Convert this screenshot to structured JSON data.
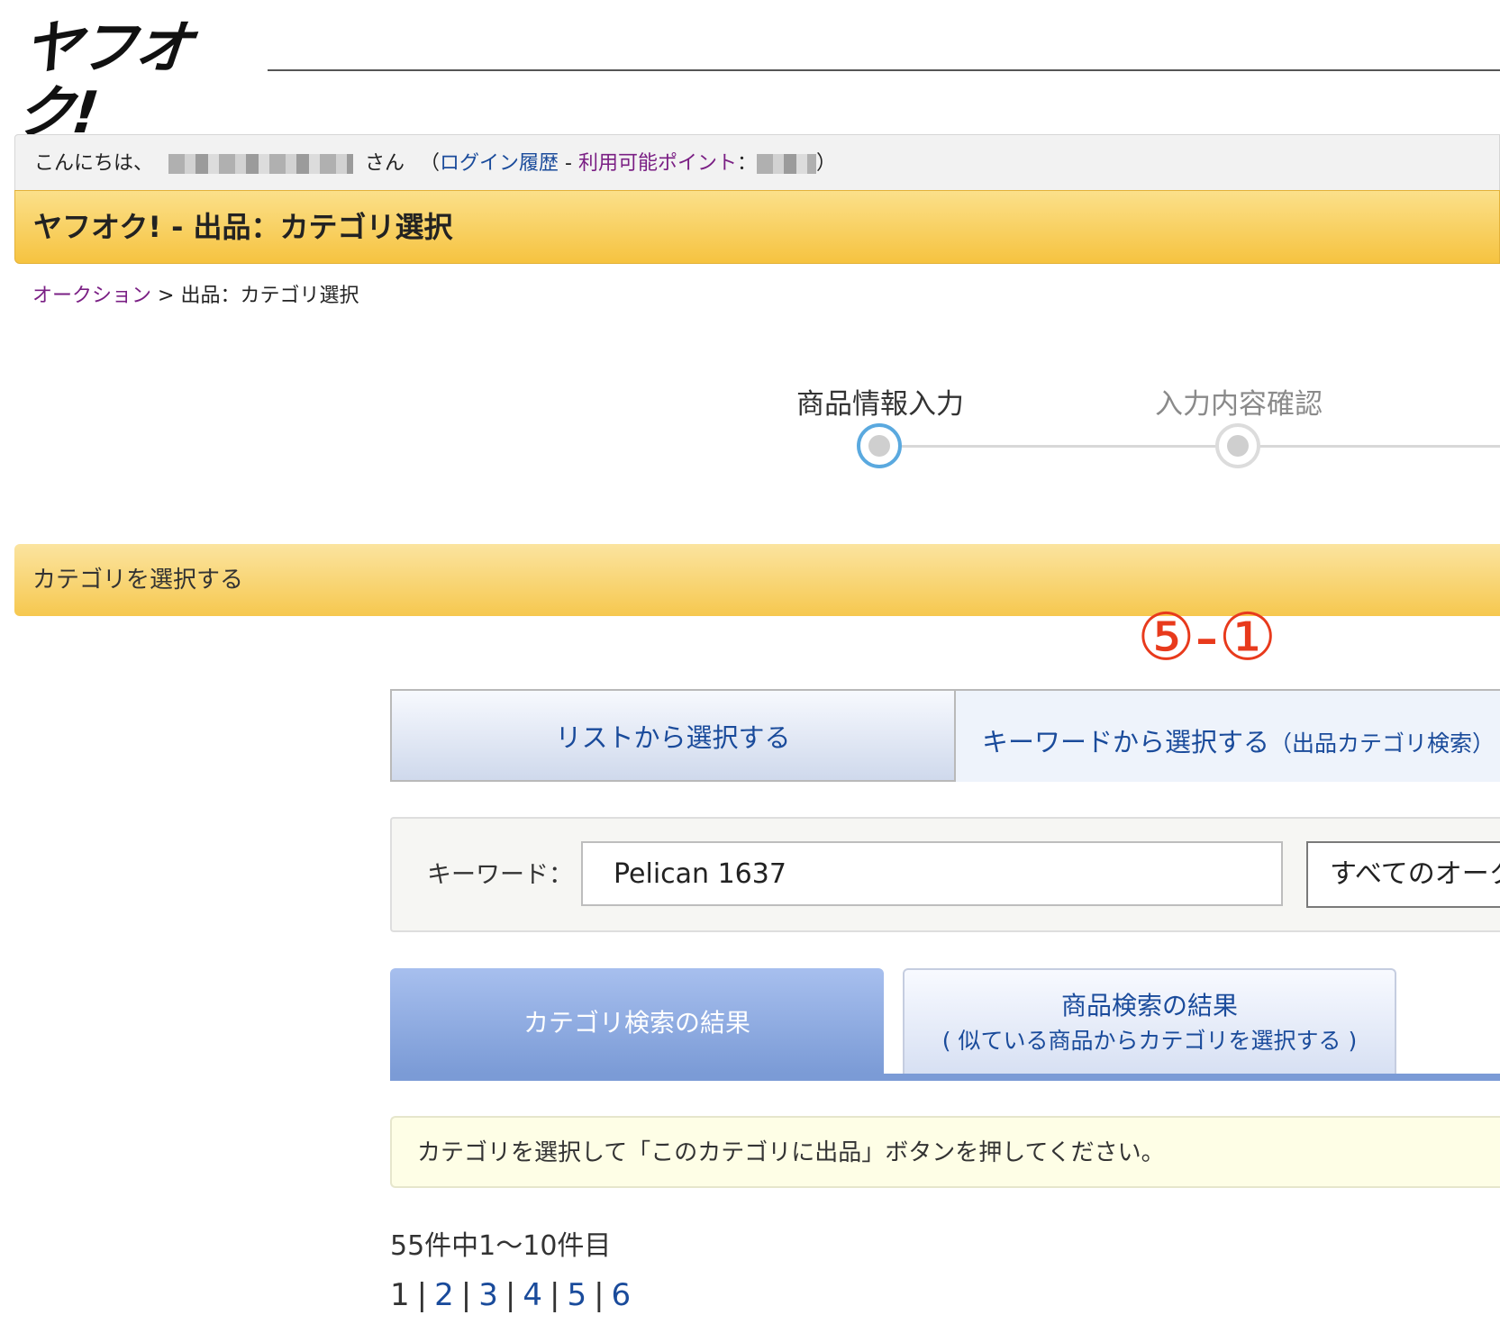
{
  "logo": {
    "text": "ヤフオク!"
  },
  "greeting": {
    "prefix": "こんにちは、",
    "suffix": "さん",
    "open_paren": "（",
    "login_history": "ログイン履歴",
    "dash": " - ",
    "points_label": "利用可能ポイント",
    "colon": "：",
    "close_paren": "）"
  },
  "title": "ヤフオク! - 出品：カテゴリ選択",
  "breadcrumb": {
    "home": "オークション",
    "sep": " > ",
    "current": "出品：カテゴリ選択"
  },
  "steps": [
    {
      "label": "商品情報入力",
      "active": true
    },
    {
      "label": "入力内容確認",
      "active": false
    }
  ],
  "section_title": "カテゴリを選択する",
  "annotation": "⑤-①",
  "tabs": {
    "list": "リストから選択する",
    "keyword": "キーワードから選択する",
    "keyword_note": "（出品カテゴリ検索）"
  },
  "search": {
    "label": "キーワード：",
    "value": "Pelican 1637",
    "scope": "すべてのオークション"
  },
  "result_tabs": {
    "category": "カテゴリ検索の結果",
    "item_title": "商品検索の結果",
    "item_note": "( 似ている商品からカテゴリを選択する )"
  },
  "notice": "カテゴリを選択して「このカテゴリに出品」ボタンを押してください。",
  "count": "55件中1～10件目",
  "pager": {
    "current": "1",
    "pages": [
      "2",
      "3",
      "4",
      "5",
      "6"
    ]
  },
  "colors": {
    "accent_yellow": "#f6c340",
    "link_blue": "#1a4b9b",
    "link_purple": "#7a1f84",
    "annotation_red": "#e83a1c",
    "tab_blue": "#7b9bd6"
  }
}
